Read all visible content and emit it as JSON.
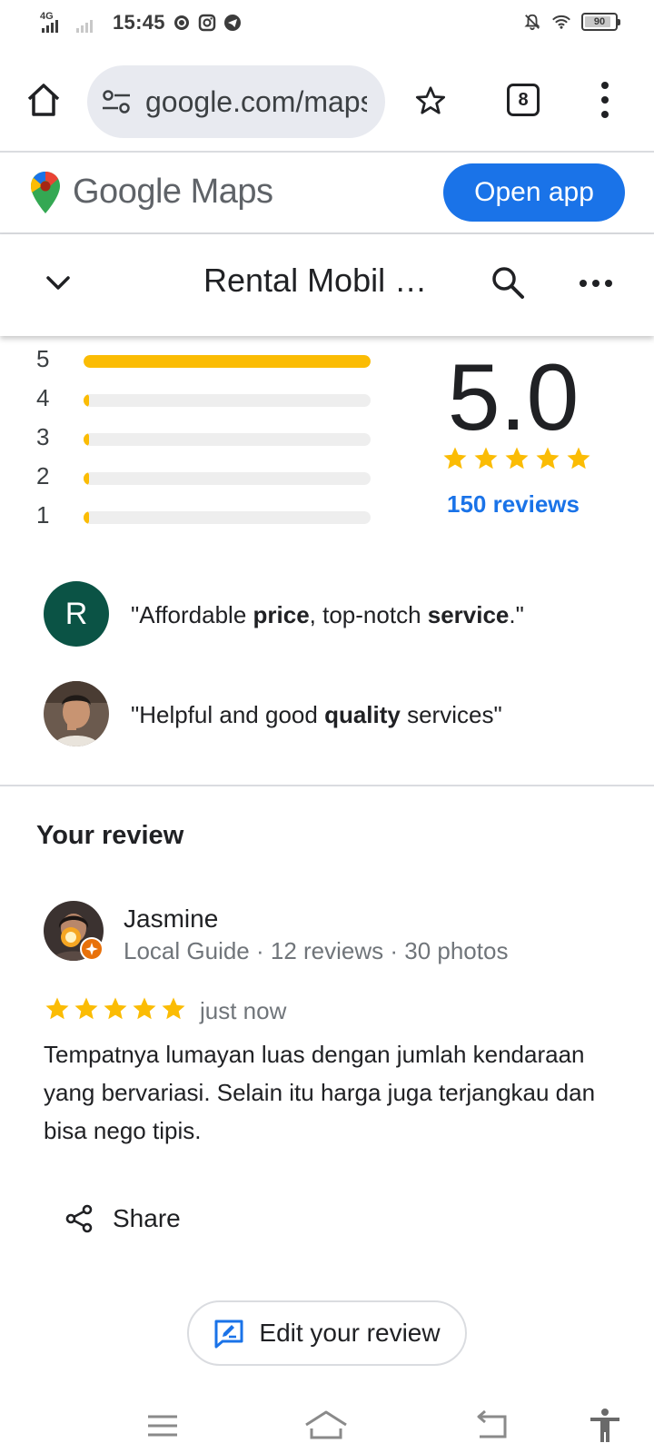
{
  "status_bar": {
    "network": "4G",
    "time": "15:45",
    "battery": "90",
    "battery_fraction": 0.9
  },
  "browser": {
    "url": "google.com/maps",
    "tab_count": "8"
  },
  "maps_header": {
    "logo_text": "Google Maps",
    "open_app_label": "Open app"
  },
  "place": {
    "title": "Rental Mobil B…"
  },
  "rating": {
    "distribution": [
      {
        "star": "5",
        "fraction": 1.0
      },
      {
        "star": "4",
        "fraction": 0.0
      },
      {
        "star": "3",
        "fraction": 0.0
      },
      {
        "star": "2",
        "fraction": 0.0
      },
      {
        "star": "1",
        "fraction": 0.0
      }
    ],
    "average": "5.0",
    "stars": 5,
    "reviews_link": "150 reviews"
  },
  "snippets": [
    {
      "avatar_letter": "R",
      "parts": [
        "\"Affordable ",
        "price",
        ", top-notch ",
        "service",
        ".\""
      ]
    },
    {
      "avatar_letter": "",
      "parts": [
        "\"Helpful and good ",
        "quality",
        " services\""
      ]
    }
  ],
  "your_review": {
    "heading": "Your review",
    "author": "Jasmine",
    "meta": "Local Guide · 12 reviews · 30 photos",
    "stars": 5,
    "time": "just now",
    "body": "Tempatnya lumayan luas dengan jumlah kendaraan yang bervariasi. Selain itu harga juga terjangkau dan bisa nego tipis.",
    "share_label": "Share",
    "edit_label": "Edit your review"
  },
  "colors": {
    "accent": "#1a73e8",
    "star": "#fbbc04",
    "avatar_r": "#0b5345",
    "local_guide_badge": "#e8710a"
  }
}
